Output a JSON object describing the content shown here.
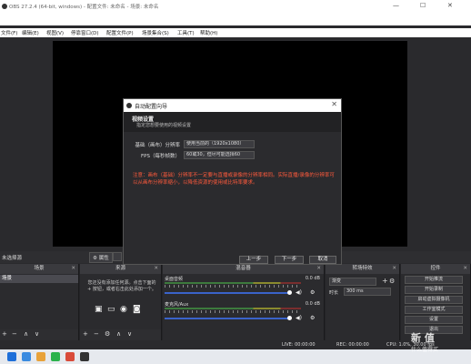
{
  "window": {
    "title": "OBS 27.2.4 (64-bit, windows) - 配置文件: 未命名 - 场景: 未命名",
    "controls": [
      "—",
      "☐",
      "✕"
    ]
  },
  "menu": [
    "文件(F)",
    "编辑(E)",
    "视图(V)",
    "停靠窗口(D)",
    "配置文件(P)",
    "场景集合(S)",
    "工具(T)",
    "帮助(H)"
  ],
  "status_row": {
    "no_source": "未选择源",
    "properties": "属性"
  },
  "docks": {
    "scenes": {
      "header": "场景",
      "item": "场景"
    },
    "sources": {
      "header": "来源",
      "tip": "您还没有添加任何源。点击下面的 + 按钮，或者右击此处添加一个。"
    },
    "mixer": {
      "header": "混音器",
      "channels": [
        {
          "name": "桌面音频",
          "db": "0.0 dB"
        },
        {
          "name": "麦克风/Aux",
          "db": "0.0 dB"
        }
      ]
    },
    "transitions": {
      "header": "转场特效",
      "selected": "渐变",
      "duration_label": "时长",
      "duration": "300 ms"
    },
    "controls": {
      "header": "控件",
      "buttons": [
        "开始推流",
        "开始录制",
        "启动虚拟摄像机",
        "工作室模式",
        "设置",
        "退出"
      ]
    }
  },
  "bottom_status": {
    "live": "LIVE: 00:00:00",
    "rec": "REC: 00:00:00",
    "cpu": "CPU: 1.0%, 30.00 fps"
  },
  "dialog": {
    "title": "自动配置向导",
    "heading": "视频设置",
    "subheading": "指定您想要使用的视频设置",
    "base_res_label": "基础（画布）分辨率",
    "base_res_value": "使用当前的（1920x1080）",
    "fps_label": "FPS（每秒帧数）",
    "fps_value": "60或30，但尽可能选择60",
    "warning": "注意：画布（基础）分辨率不一定要与直播或录像的分辨率相同。实际直播/录像的分辨率可以从画布分辨率缩小，以降低资源的使用或比特率要求。",
    "back": "上一步",
    "next": "下一步",
    "cancel": "取消"
  },
  "watermark": {
    "main": "新 值",
    "sub": "什么值得买"
  }
}
